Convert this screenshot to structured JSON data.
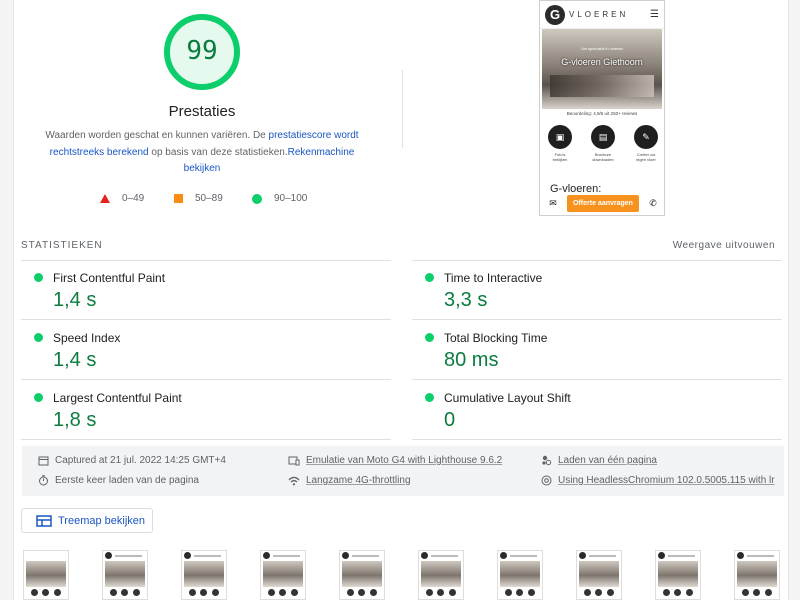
{
  "score": {
    "value": "99",
    "fraction": 0.99,
    "title": "Prestaties",
    "color": "#0cce6b",
    "description": {
      "p1": "Waarden worden geschat en kunnen variëren. De ",
      "link1": "prestatiescore wordt rechtstreeks berekend",
      "p2": " op basis van deze statistieken.",
      "link2": "Rekenmachine bekijken"
    }
  },
  "legend": [
    {
      "range": "0–49",
      "shape": "triangle",
      "color": "#e2231a"
    },
    {
      "range": "50–89",
      "shape": "square",
      "color": "#fa8c16"
    },
    {
      "range": "90–100",
      "shape": "circle",
      "color": "#0cce6b"
    }
  ],
  "screenshot": {
    "brand": "VLOEREN",
    "logo_letter": "G",
    "hero_title": "G-vloeren Giethoorn",
    "hero_sub": "Uw specialist in vloeren",
    "rating": "Beoordeling: 4,9/5 uit 250+ reviews",
    "icons": [
      {
        "label": "Foto's bekijken"
      },
      {
        "label": "Brochure downloaden"
      },
      {
        "label": "Creëer uw eigen vloer"
      }
    ],
    "section_title": "G-vloeren:",
    "cta": "Offerte aanvragen"
  },
  "stats": {
    "title": "STATISTIEKEN",
    "toggle": "Weergave uitvouwen",
    "metrics": [
      {
        "name": "First Contentful Paint",
        "value": "1,4 s"
      },
      {
        "name": "Time to Interactive",
        "value": "3,3 s"
      },
      {
        "name": "Speed Index",
        "value": "1,4 s"
      },
      {
        "name": "Total Blocking Time",
        "value": "80 ms"
      },
      {
        "name": "Largest Contentful Paint",
        "value": "1,8 s"
      },
      {
        "name": "Cumulative Layout Shift",
        "value": "0"
      }
    ]
  },
  "runtime": {
    "captured": "Captured at 21 jul. 2022 14:25 GMT+4",
    "device": "Emulatie van Moto G4 with Lighthouse 9.6.2",
    "session": "Laden van één pagina",
    "load": "Eerste keer laden van de pagina",
    "throttle": "Langzame 4G-throttling",
    "browser": "Using HeadlessChromium 102.0.5005.115 with lr"
  },
  "treemap_label": "Treemap bekijken"
}
